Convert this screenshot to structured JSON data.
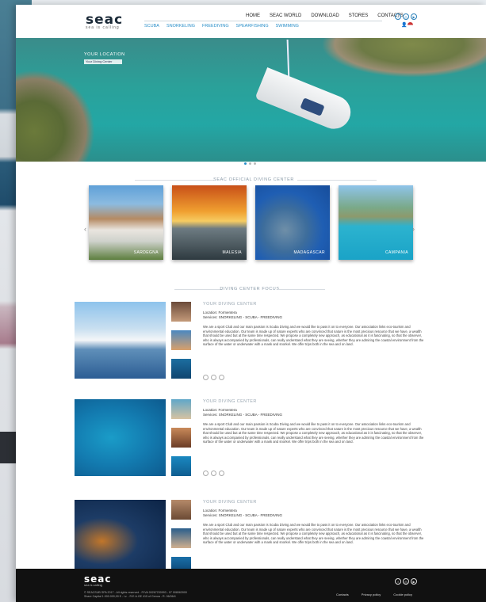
{
  "header": {
    "logo": "seac",
    "tagline": "sea is calling",
    "main_nav": [
      "HOME",
      "SEAC WORLD",
      "DOWNLOAD",
      "STORES",
      "CONTACTS"
    ],
    "sub_nav": [
      "SCUBA",
      "SNORKELING",
      "FREEDIVING",
      "SPEARFISHING",
      "SWIMMING"
    ]
  },
  "hero": {
    "location_label": "YOUR LOCATION",
    "location_value": "Your Diving Center"
  },
  "official": {
    "title": "SEAC OFFICIAL DIVING CENTER",
    "cards": [
      {
        "label": "SARDEGNA"
      },
      {
        "label": "MALESIA"
      },
      {
        "label": "MADAGASCAR"
      },
      {
        "label": "CAMPANIA"
      }
    ]
  },
  "focus": {
    "title": "DIVING CENTER FOCUS",
    "items": [
      {
        "heading": "YOUR DIVING CENTER",
        "location": "Location: Formentera",
        "services": "Services: SNORKELING - SCUBA - FREEDIVING",
        "body": "We are a sport Club and our main passion is Scuba Diving and we would like to pass it on to everyone. Our association links eco-tourism and environmental education. Our team is made up of nature experts who are convinced that nature is the most precious resource that we have, a wealth that should be used but at the same time respected. We propose a completely new approach, as educational as it is fascinating, so that the observer, who is always accompanied by professionals, can really understand what they are seeing, whether they are admiring the coastal environment from the surface of the water or underwater with a mask and snorkel. We offer trips both in the sea and on land."
      },
      {
        "heading": "YOUR DIVING CENTER",
        "location": "Location: Formentera",
        "services": "Services: SNORKELING - SCUBA - FREEDIVING",
        "body": "We are a sport Club and our main passion is Scuba Diving and we would like to pass it on to everyone. Our association links eco-tourism and environmental education. Our team is made up of nature experts who are convinced that nature is the most precious resource that we have, a wealth that should be used but at the same time respected. We propose a completely new approach, as educational as it is fascinating, so that the observer, who is always accompanied by professionals, can really understand what they are seeing, whether they are admiring the coastal environment from the surface of the water or underwater with a mask and snorkel. We offer trips both in the sea and on land."
      },
      {
        "heading": "YOUR DIVING CENTER",
        "location": "Location: Formentera",
        "services": "Services: SNORKELING - SCUBA - FREEDIVING",
        "body": "We are a sport Club and our main passion is Scuba Diving and we would like to pass it on to everyone. Our association links eco-tourism and environmental education. Our team is made up of nature experts who are convinced that nature is the most precious resource that we have, a wealth that should be used but at the same time respected. We propose a completely new approach, as educational as it is fascinating, so that the observer, who is always accompanied by professionals, can really understand what they are seeing, whether they are admiring the coastal environment from the surface of the water or underwater with a mask and snorkel. We offer trips both in the sea and on land."
      }
    ]
  },
  "footer": {
    "logo": "seac",
    "tagline": "sea is calling",
    "copyright": "© SEACSUB SPA 2017 - All rights reserved - P.IVA 00267230993 - 07 008063900",
    "address": "Share Capital 1.000.000,00 € - i.v. - R.E.A.GE 415 of Genoa - R. 06/06/4",
    "links": [
      "Contacts",
      "Privacy policy",
      "Cookie policy"
    ]
  },
  "colors": {
    "accent": "#2a8fc9",
    "footer_bg": "#111111"
  }
}
